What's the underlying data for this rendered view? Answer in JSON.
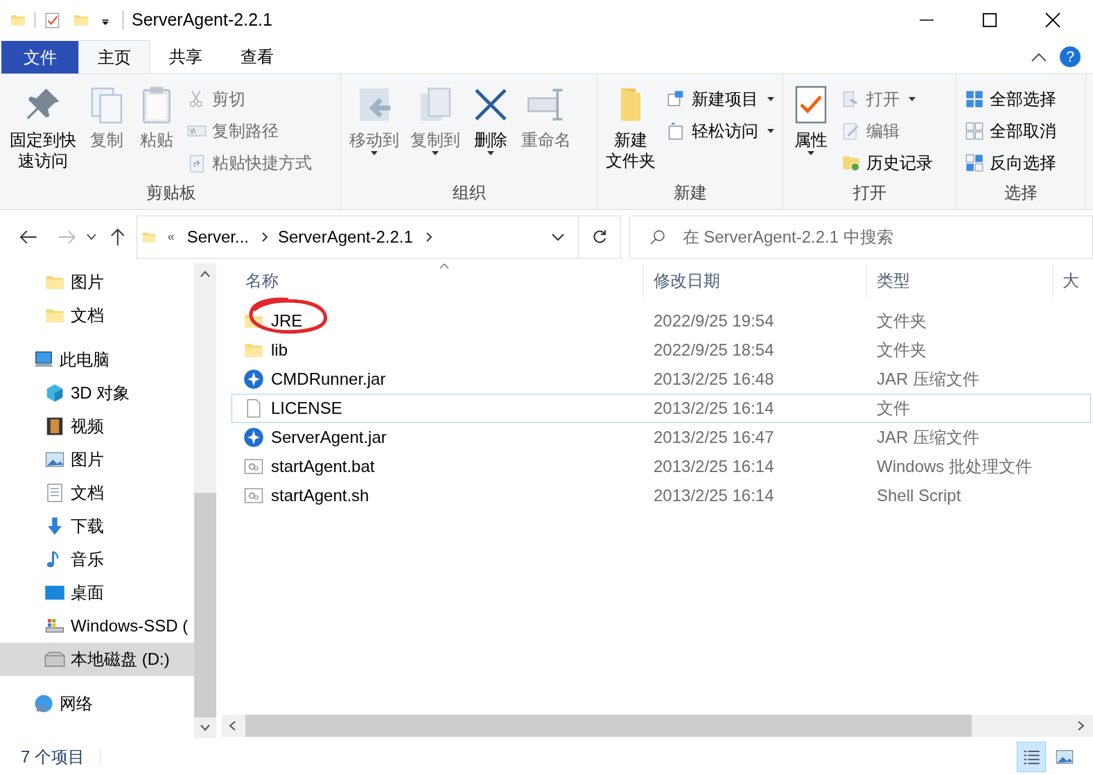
{
  "window": {
    "title": "ServerAgent-2.2.1"
  },
  "ribbon": {
    "help": "?",
    "tabs": [
      {
        "label": "文件",
        "kind": "file",
        "selected": false
      },
      {
        "label": "主页",
        "kind": "tab",
        "selected": true
      },
      {
        "label": "共享",
        "kind": "tab",
        "selected": false
      },
      {
        "label": "查看",
        "kind": "tab",
        "selected": false
      }
    ],
    "groups": [
      {
        "label": "剪贴板",
        "buttons": [
          {
            "lines": [
              "固定到快",
              "速访问"
            ],
            "kind": "large",
            "disabled": false,
            "menu": false
          },
          {
            "label": "复制",
            "kind": "large",
            "disabled": true,
            "menu": false
          },
          {
            "label": "粘贴",
            "kind": "large",
            "disabled": true,
            "menu": false
          },
          {
            "label": "剪切",
            "kind": "small",
            "disabled": true,
            "menu": false
          },
          {
            "label": "复制路径",
            "kind": "small",
            "disabled": true,
            "menu": false
          },
          {
            "label": "粘贴快捷方式",
            "kind": "small",
            "disabled": true,
            "menu": false
          }
        ]
      },
      {
        "label": "组织",
        "buttons": [
          {
            "label": "移动到",
            "kind": "large",
            "disabled": true,
            "menu": true
          },
          {
            "label": "复制到",
            "kind": "large",
            "disabled": true,
            "menu": true
          },
          {
            "label": "删除",
            "kind": "large",
            "disabled": false,
            "menu": true
          },
          {
            "label": "重命名",
            "kind": "large",
            "disabled": true,
            "menu": false
          }
        ]
      },
      {
        "label": "新建",
        "buttons": [
          {
            "lines": [
              "新建",
              "文件夹"
            ],
            "kind": "large",
            "disabled": false,
            "menu": false
          },
          {
            "label": "新建项目",
            "kind": "small",
            "disabled": false,
            "menu": true
          },
          {
            "label": "轻松访问",
            "kind": "small",
            "disabled": false,
            "menu": true
          }
        ]
      },
      {
        "label": "打开",
        "buttons": [
          {
            "label": "属性",
            "kind": "large",
            "disabled": false,
            "menu": true
          },
          {
            "label": "打开",
            "kind": "small",
            "disabled": true,
            "menu": true
          },
          {
            "label": "编辑",
            "kind": "small",
            "disabled": true,
            "menu": false
          },
          {
            "label": "历史记录",
            "kind": "small",
            "disabled": false,
            "menu": false
          }
        ]
      },
      {
        "label": "选择",
        "buttons": [
          {
            "label": "全部选择",
            "kind": "small",
            "disabled": false,
            "menu": false
          },
          {
            "label": "全部取消",
            "kind": "small",
            "disabled": false,
            "menu": false
          },
          {
            "label": "反向选择",
            "kind": "small",
            "disabled": false,
            "menu": false
          }
        ]
      }
    ]
  },
  "address": {
    "overflow": "«",
    "crumbs": [
      "Server...",
      "ServerAgent-2.2.1"
    ]
  },
  "search": {
    "placeholder": "在 ServerAgent-2.2.1 中搜索"
  },
  "nav": {
    "items": [
      {
        "children": [
          {
            "label": "图片",
            "selected": false
          },
          {
            "label": "文档",
            "selected": false
          }
        ]
      },
      {
        "label": "此电脑",
        "selected": false,
        "children": [
          {
            "label": "3D 对象",
            "selected": false
          },
          {
            "label": "视频",
            "selected": false
          },
          {
            "label": "图片",
            "selected": false
          },
          {
            "label": "文档",
            "selected": false
          },
          {
            "label": "下载",
            "selected": false
          },
          {
            "label": "音乐",
            "selected": false
          },
          {
            "label": "桌面",
            "selected": false
          },
          {
            "label": "Windows-SSD (",
            "selected": false
          },
          {
            "label": "本地磁盘 (D:)",
            "selected": true
          }
        ]
      },
      {
        "label": "网络",
        "selected": false
      }
    ]
  },
  "files": {
    "columns": [
      {
        "label": "名称",
        "sorted": true
      },
      {
        "label": "修改日期",
        "sorted": false
      },
      {
        "label": "类型",
        "sorted": false
      },
      {
        "label": "大",
        "sorted": false
      }
    ],
    "rows": [
      {
        "name": "JRE",
        "date": "2022/9/25 19:54",
        "type": "文件夹",
        "kind": "folder",
        "highlighted": false
      },
      {
        "name": "lib",
        "date": "2022/9/25 18:54",
        "type": "文件夹",
        "kind": "folder",
        "highlighted": false
      },
      {
        "name": "CMDRunner.jar",
        "date": "2013/2/25 16:48",
        "type": "JAR 压缩文件",
        "kind": "jar",
        "highlighted": false
      },
      {
        "name": "LICENSE",
        "date": "2013/2/25 16:14",
        "type": "文件",
        "kind": "file",
        "highlighted": true
      },
      {
        "name": "ServerAgent.jar",
        "date": "2013/2/25 16:47",
        "type": "JAR 压缩文件",
        "kind": "jar",
        "highlighted": false
      },
      {
        "name": "startAgent.bat",
        "date": "2013/2/25 16:14",
        "type": "Windows 批处理文件",
        "kind": "script",
        "highlighted": false
      },
      {
        "name": "startAgent.sh",
        "date": "2013/2/25 16:14",
        "type": "Shell Script",
        "kind": "script",
        "highlighted": false
      }
    ]
  },
  "status_bar": {
    "count": "7 个项目",
    "views": [
      {
        "kind": "details",
        "selected": true
      },
      {
        "kind": "tiles",
        "selected": false
      }
    ]
  }
}
